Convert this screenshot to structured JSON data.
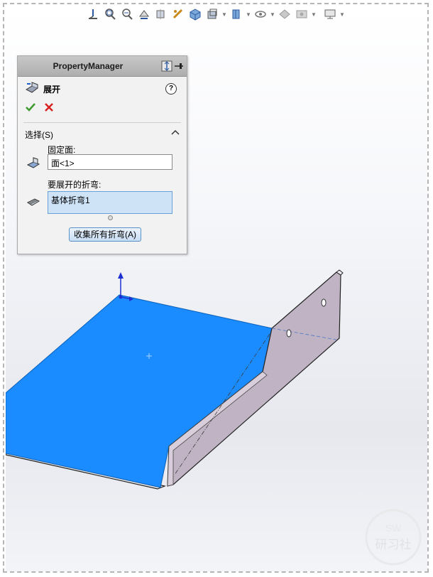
{
  "heads_up_toolbar": {
    "icons": [
      "view-orientation-icon",
      "zoom-to-fit-icon",
      "zoom-area-icon",
      "previous-view-icon",
      "section-view-icon",
      "dynamic-annotation-icon",
      "view-orientation-cube-icon",
      "display-style-icon",
      "hide-show-items-icon",
      "edit-appearance-icon",
      "apply-scene-icon",
      "view-settings-icon"
    ]
  },
  "property_manager": {
    "title": "PropertyManager",
    "feature_name": "展开",
    "help_symbol": "?",
    "selection_group": {
      "title": "选择(S)",
      "fixed_face_label": "固定面:",
      "fixed_face_value": "面<1>",
      "bends_label": "要展开的折弯:",
      "bends_items": [
        "基体折弯1"
      ],
      "collect_button": "收集所有折弯(A)"
    }
  },
  "colors": {
    "selected_face": "#1a8cff",
    "sheet_metal": "#c0b4c4",
    "panel_bg": "#f2f2f2",
    "accent_blue": "#5b8fc7"
  },
  "watermark": {
    "logo_text": "SW",
    "logo_chars": "研习社"
  }
}
